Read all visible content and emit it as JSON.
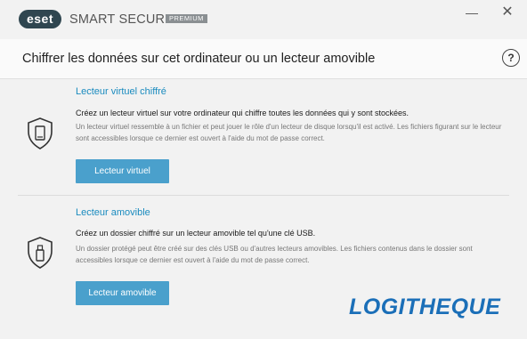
{
  "titlebar": {
    "logo_text": "eset",
    "product_name": "SMART SECURITY",
    "edition_badge": "PREMIUM",
    "minimize_glyph": "—",
    "close_glyph": "✕"
  },
  "header": {
    "title": "Chiffrer les données sur cet ordinateur ou un lecteur amovible",
    "help_glyph": "?"
  },
  "sections": [
    {
      "icon": "shield-drive-icon",
      "title": "Lecteur virtuel chiffré",
      "description": "Créez un lecteur virtuel sur votre ordinateur qui chiffre toutes les données qui y sont stockées.",
      "detail": "Un lecteur virtuel ressemble à un fichier et peut jouer le rôle d'un lecteur de disque lorsqu'il est activé. Les fichiers figurant sur le lecteur sont accessibles lorsque ce dernier est ouvert à l'aide du mot de passe correct.",
      "button_label": "Lecteur virtuel"
    },
    {
      "icon": "shield-usb-icon",
      "title": "Lecteur amovible",
      "description": "Créez un dossier chiffré sur un lecteur amovible tel qu'une clé USB.",
      "detail": "Un dossier protégé peut être créé sur des clés USB ou d'autres lecteurs amovibles. Les fichiers contenus dans le dossier sont accessibles lorsque ce dernier est ouvert à l'aide du mot de passe correct.",
      "button_label": "Lecteur amovible"
    }
  ],
  "watermark": "LOGITHEQUE",
  "colors": {
    "accent": "#1a8bbf",
    "button": "#4aa0cc",
    "logo_bg": "#2f4650",
    "watermark": "#1b6fb8"
  }
}
